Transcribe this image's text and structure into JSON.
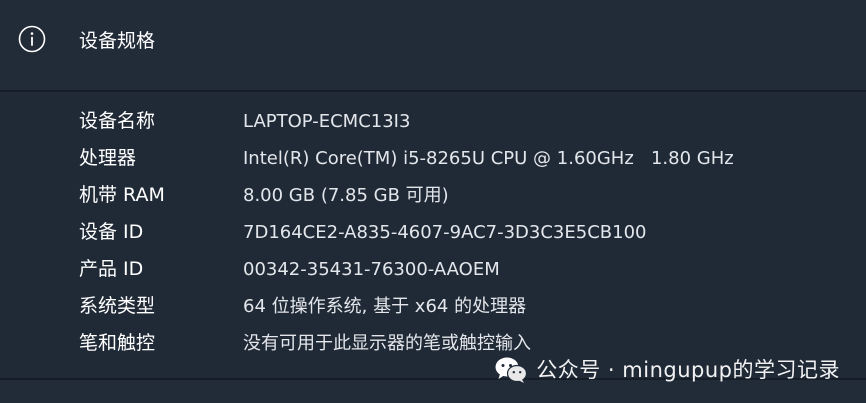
{
  "section": {
    "title": "设备规格",
    "icon": "info-icon"
  },
  "specs": [
    {
      "label": "设备名称",
      "value": "LAPTOP-ECMC13I3"
    },
    {
      "label": "处理器",
      "value": "Intel(R) Core(TM) i5-8265U CPU @ 1.60GHz   1.80 GHz"
    },
    {
      "label": "机带 RAM",
      "value": "8.00 GB (7.85 GB 可用)"
    },
    {
      "label": "设备 ID",
      "value": "7D164CE2-A835-4607-9AC7-3D3C3E5CB100"
    },
    {
      "label": "产品 ID",
      "value": "00342-35431-76300-AAOEM"
    },
    {
      "label": "系统类型",
      "value": "64 位操作系统, 基于 x64 的处理器"
    },
    {
      "label": "笔和触控",
      "value": "没有可用于此显示器的笔或触控输入"
    }
  ],
  "watermark": {
    "icon": "wechat-icon",
    "text": "公众号 · mingupup的学习记录"
  },
  "colors": {
    "background": "#202a37",
    "header_background": "#222c39",
    "divider": "#161d27",
    "text_primary": "#ffffff",
    "text_value": "#e3e6ea"
  }
}
